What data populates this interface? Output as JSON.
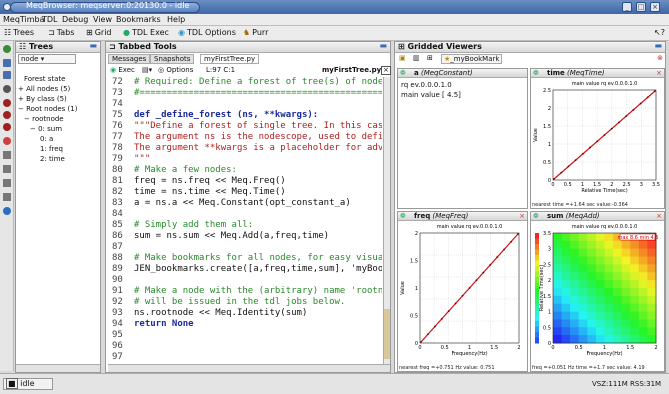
{
  "window": {
    "title": "MeqBrowser: meqserver:0:20130.0 - idle"
  },
  "menu": [
    "MeqTimba",
    "TDL",
    "Debug",
    "View",
    "Bookmarks",
    "Help"
  ],
  "toolbar": {
    "trees": "Trees",
    "tabs": "Tabs",
    "grid": "Grid",
    "tdl_exec": "TDL Exec",
    "tdl_options": "TDL Options",
    "purr": "Purr"
  },
  "trees": {
    "title": "Trees",
    "selector": "node",
    "items": [
      "Forest state",
      "All nodes (5)",
      "By class (5)",
      "Root nodes (1)",
      "rootnode",
      "0: sum",
      "0: a",
      "1: freq",
      "2: time"
    ]
  },
  "tabbed": {
    "title": "Tabbed Tools",
    "tabs": [
      "Messages",
      "Snapshots",
      "myFirstTree.py"
    ],
    "exec": "Exec",
    "options": "Options",
    "pos": "L:97 C:1",
    "file": "myFirstTree.py"
  },
  "code": {
    "lines": [
      {
        "n": "72",
        "t": "# Required: Define a forest of tree(s) of nodes:"
      },
      {
        "n": "73",
        "t": "#=============================================="
      },
      {
        "n": "74",
        "t": ""
      },
      {
        "n": "75",
        "t": "def _define_forest (ns, **kwargs):"
      },
      {
        "n": "76",
        "t": "   \"\"\"Define a forest of single tree. In this case a very"
      },
      {
        "n": "77",
        "t": "   The argument ns is the nodescope, used to define nodes."
      },
      {
        "n": "78",
        "t": "   The argument **kwargs is a placeholder for advanced use"
      },
      {
        "n": "79",
        "t": "   \"\"\""
      },
      {
        "n": "80",
        "t": "   # Make a few nodes:"
      },
      {
        "n": "81",
        "t": "   freq = ns.freq << Meq.Freq()"
      },
      {
        "n": "82",
        "t": "   time = ns.time << Meq.Time()"
      },
      {
        "n": "83",
        "t": "   a = ns.a << Meq.Constant(opt_constant_a)"
      },
      {
        "n": "84",
        "t": ""
      },
      {
        "n": "85",
        "t": "   # Simply add them all:"
      },
      {
        "n": "86",
        "t": "   sum = ns.sum << Meq.Add(a,freq,time)"
      },
      {
        "n": "87",
        "t": ""
      },
      {
        "n": "88",
        "t": "   # Make bookmarks for all nodes, for easy visualisation:"
      },
      {
        "n": "89",
        "t": "   JEN_bookmarks.create([a,freq,time,sum], 'myBookMark')"
      },
      {
        "n": "90",
        "t": ""
      },
      {
        "n": "91",
        "t": "   # Make a node with the (arbitrary) name 'rootnode', to wh"
      },
      {
        "n": "92",
        "t": "   # will be issued in the tdl jobs below."
      },
      {
        "n": "93",
        "t": "   ns.rootnode << Meq.Identity(sum)"
      },
      {
        "n": "94",
        "t": "   return None"
      },
      {
        "n": "95",
        "t": ""
      },
      {
        "n": "96",
        "t": ""
      },
      {
        "n": "97",
        "t": ""
      }
    ]
  },
  "gridded": {
    "title": "Gridded Viewers",
    "bookmark_tab": "myBookMark",
    "a": {
      "name": "a",
      "class": "(MeqConstant)",
      "rq": "rq ev.0.0.0.1.0",
      "value": "main value  [ 4.5]"
    },
    "time": {
      "name": "time",
      "class": "(MeqTime)",
      "plot_title": "main value  rq ev.0.0.0.1.0",
      "xlabel": "Relative Time(sec)",
      "ylabel": "Value",
      "footer": "nearest time =+1.64 sec  value:-0.364"
    },
    "freq": {
      "name": "freq",
      "class": "(MeqFreq)",
      "plot_title": "main value  rq ev.0.0.0.1.0",
      "xlabel": "Frequency(Hz)",
      "ylabel": "Value",
      "footer": "nearest freq =+0.751 Hz  value: 0.751"
    },
    "sum": {
      "name": "sum",
      "class": "(MeqAdd)",
      "plot_title": "main value  rq ev.0.0.0.1.0",
      "xlabel": "Frequency(Hz)",
      "ylabel": "Relative Time(sec)",
      "badge": "max 8.6 min 4.5",
      "footer": "freq =+0.051 Hz  time =+1.7 sec  value: 4.19"
    }
  },
  "status": {
    "state": "idle",
    "mem": "VSZ:111M RSS:31M"
  }
}
